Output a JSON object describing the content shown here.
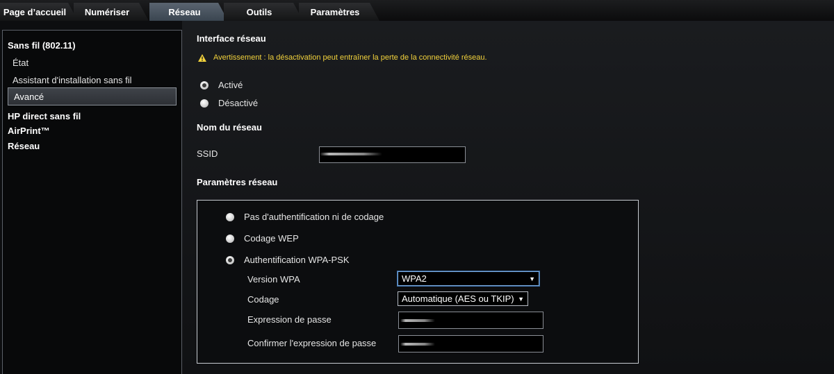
{
  "tabs": [
    {
      "label": "Page d’accueil",
      "active": false
    },
    {
      "label": "Numériser",
      "active": false
    },
    {
      "label": "Réseau",
      "active": true
    },
    {
      "label": "Outils",
      "active": false
    },
    {
      "label": "Paramètres",
      "active": false
    }
  ],
  "sidebar": {
    "wireless_heading": "Sans fil (802.11)",
    "items": [
      "État",
      "Assistant d'installation sans fil",
      "Avancé"
    ],
    "selected_item": "Avancé",
    "hp_direct": "HP direct sans fil",
    "airprint": "AirPrint™",
    "network": "Réseau"
  },
  "interface": {
    "title": "Interface réseau",
    "warning": "Avertissement : la désactivation peut entraîner la perte de la connectivité réseau.",
    "options": [
      "Activé",
      "Désactivé"
    ],
    "selected": "Activé"
  },
  "network_name": {
    "title": "Nom du réseau",
    "ssid_label": "SSID",
    "ssid_value": ""
  },
  "network_params": {
    "title": "Paramètres réseau",
    "auth_options": [
      "Pas d'authentification ni de codage",
      "Codage WEP",
      "Authentification WPA-PSK"
    ],
    "selected_auth": "Authentification WPA-PSK",
    "wpa_version_label": "Version WPA",
    "wpa_version_value": "WPA2",
    "encoding_label": "Codage",
    "encoding_value": "Automatique (AES ou TKIP)",
    "passphrase_label": "Expression de passe",
    "confirm_passphrase_label": "Confirmer l'expression de passe"
  },
  "colors": {
    "warning_text": "#f2d23c",
    "active_tab": "#4a5560"
  }
}
